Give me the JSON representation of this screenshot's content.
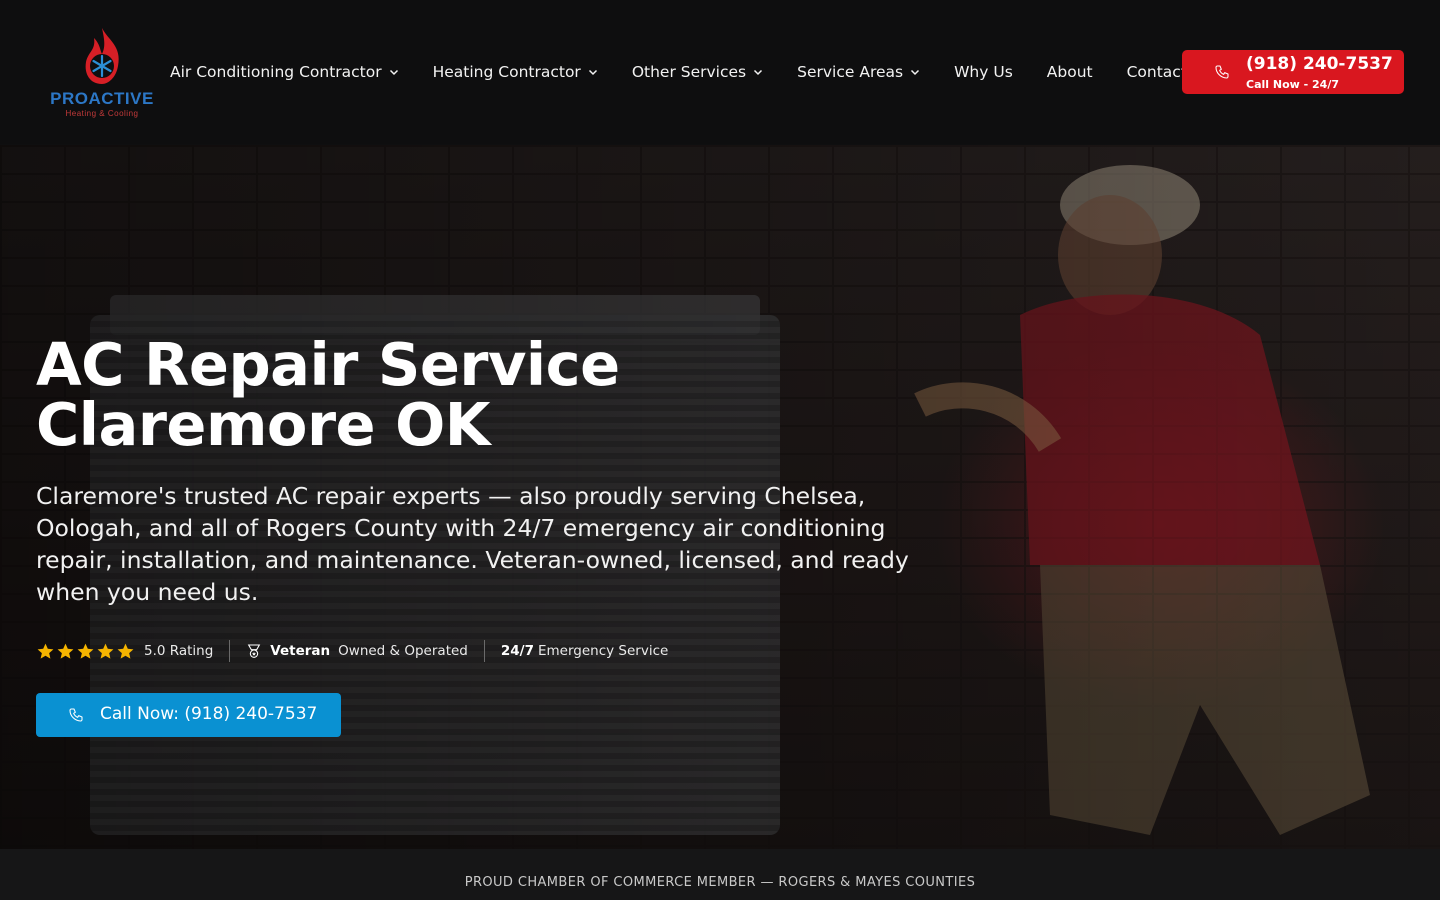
{
  "header": {
    "logo": {
      "brand": "PROACTIVE",
      "tagline": "Heating & Cooling"
    },
    "nav": [
      {
        "label": "Air Conditioning Contractor",
        "dropdown": true
      },
      {
        "label": "Heating Contractor",
        "dropdown": true
      },
      {
        "label": "Other Services",
        "dropdown": true
      },
      {
        "label": "Service Areas",
        "dropdown": true
      },
      {
        "label": "Why Us",
        "dropdown": false
      },
      {
        "label": "About",
        "dropdown": false
      },
      {
        "label": "Contact",
        "dropdown": false
      }
    ],
    "call_button": {
      "number": "(918) 240-7537",
      "sub": "Call Now - 24/7",
      "color": "#d9171f",
      "icon": "phone-icon"
    }
  },
  "hero": {
    "title": "AC Repair Service Claremore OK",
    "description": "Claremore's trusted AC repair experts — also proudly serving Chelsea, Oologah, and all of Rogers County with 24/7 emergency air conditioning repair, installation, and maintenance. Veteran-owned, licensed, and ready when you need us.",
    "badges": {
      "rating": {
        "stars": 5,
        "label": "5.0 Rating"
      },
      "veteran": {
        "strong": "Veteran",
        "label": "Owned & Operated",
        "icon": "veteran-badge-icon"
      },
      "emergency": {
        "strong": "24/7",
        "label": "Emergency Service"
      }
    },
    "cta": {
      "label": "Call Now: (918) 240-7537",
      "color": "#0a91d2",
      "icon": "phone-icon"
    }
  },
  "strip": {
    "text": "PROUD CHAMBER OF COMMERCE MEMBER — ROGERS & MAYES COUNTIES"
  },
  "colors": {
    "accent_red": "#d9171f",
    "accent_blue": "#0a91d2",
    "star": "#f5b400",
    "background": "#0e0e0f"
  }
}
